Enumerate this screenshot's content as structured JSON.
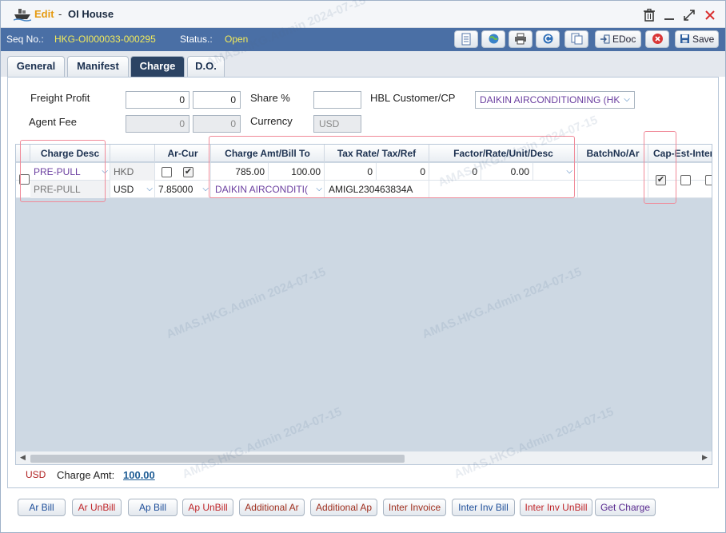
{
  "title": {
    "mode": "Edit",
    "separator": "-",
    "name": "OI House"
  },
  "seqbar": {
    "seq_label": "Seq No.:",
    "seq_value": "HKG-OI000033-000295",
    "status_label": "Status.:",
    "status_value": "Open",
    "edoc_label": "EDoc",
    "save_label": "Save"
  },
  "tabs": [
    {
      "label": "General"
    },
    {
      "label": "Manifest"
    },
    {
      "label": "Charge"
    },
    {
      "label": "D.O."
    }
  ],
  "form": {
    "freight_profit_label": "Freight Profit",
    "freight_profit_1": "0",
    "freight_profit_2": "0",
    "share_label": "Share %",
    "share_value": "",
    "hbl_label": "HBL Customer/CP",
    "hbl_value": "DAIKIN AIRCONDITIONING (HK",
    "agent_fee_label": "Agent Fee",
    "agent_fee_1": "0",
    "agent_fee_2": "0",
    "currency_label": "Currency",
    "currency_value": "USD"
  },
  "grid": {
    "headers": {
      "charge_desc": "Charge Desc",
      "ar_cur": "Ar-Cur",
      "charge_amt": "Charge Amt/Bill To",
      "tax": "Tax Rate/ Tax/Ref",
      "factor": "Factor/Rate/Unit/Desc",
      "batch": "BatchNo/Ar",
      "cap": "Cap-Est-Inter"
    },
    "row1": {
      "charge_desc": "PRE-PULL",
      "currency": "HKD",
      "amount": "785.00",
      "bill_to": "100.00",
      "tax_rate": "0",
      "tax": "0",
      "factor": "0",
      "rate": "0.00"
    },
    "row2": {
      "charge_desc": "PRE-PULL",
      "currency": "USD",
      "rate": "7.85000",
      "bill_to": "DAIKIN AIRCONDITI(",
      "tax_ref": "AMIGL230463834A"
    }
  },
  "footer": {
    "currency": "USD",
    "charge_amt_label": "Charge Amt:",
    "charge_amt_value": "100.00"
  },
  "buttons": [
    {
      "label": "Ar Bill",
      "color": "#1f4f9a"
    },
    {
      "label": "Ar UnBill",
      "color": "#c0262a"
    },
    {
      "label": "Ap Bill",
      "color": "#1f4f9a"
    },
    {
      "label": "Ap UnBill",
      "color": "#c0262a"
    },
    {
      "label": "Additional Ar",
      "color": "#a0301f"
    },
    {
      "label": "Additional Ap",
      "color": "#a0301f"
    },
    {
      "label": "Inter Invoice",
      "color": "#a0301f"
    },
    {
      "label": "Inter Inv Bill",
      "color": "#1f4f9a"
    },
    {
      "label": "Inter Inv UnBill",
      "color": "#c0262a"
    },
    {
      "label": "Get Charge",
      "color": "#5a2a90"
    }
  ],
  "watermark": "AMAS.HKG.Admin 2024-07-15",
  "icons": [
    "ship-icon",
    "trash-icon",
    "minimize-icon",
    "maximize-icon",
    "close-icon",
    "document-icon",
    "globe-icon",
    "print-icon",
    "refresh-icon",
    "copy-icon",
    "edoc-icon",
    "cancel-icon",
    "save-icon",
    "chevron-down-icon",
    "checkbox-icon"
  ]
}
